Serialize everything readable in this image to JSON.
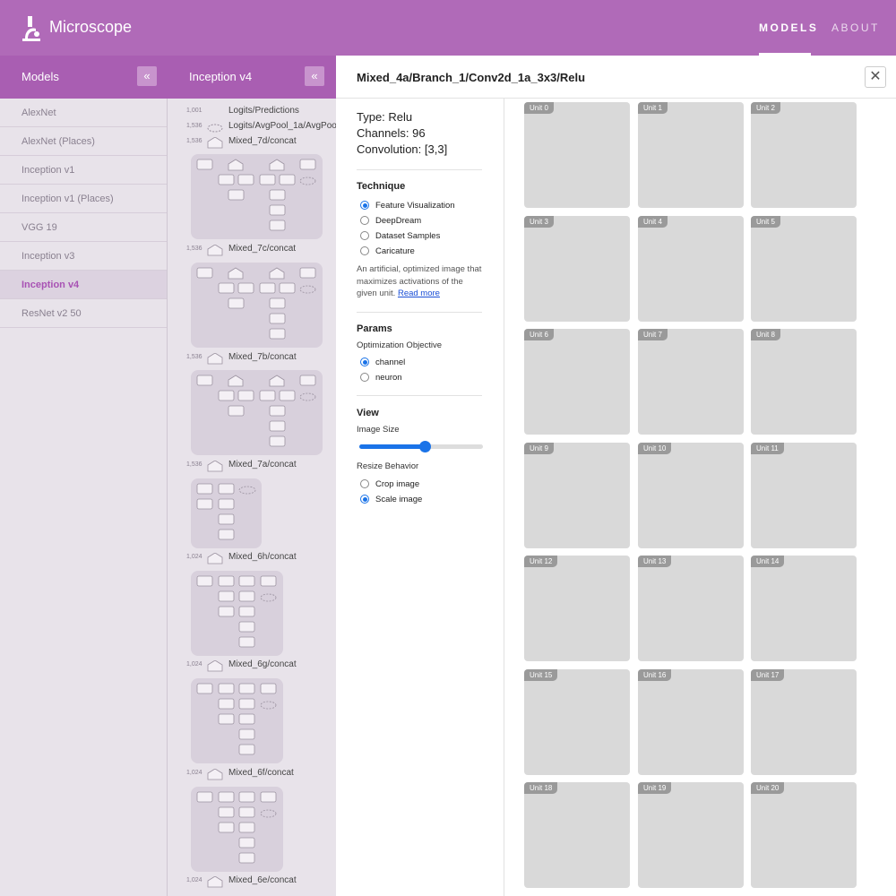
{
  "app": {
    "name": "Microscope"
  },
  "nav": {
    "models": "MODELS",
    "about": "ABOUT"
  },
  "models_panel": {
    "title": "Models",
    "collapse": "«",
    "items": [
      "AlexNet",
      "AlexNet (Places)",
      "Inception v1",
      "Inception v1 (Places)",
      "VGG 19",
      "Inception v3",
      "Inception v4",
      "ResNet v2 50"
    ],
    "active": "Inception v4"
  },
  "graph_panel": {
    "title": "Inception v4",
    "collapse": "«",
    "nodes": [
      {
        "count": "1,001",
        "label": "Logits/Predictions"
      },
      {
        "count": "1,536",
        "label": "Logits/AvgPool_1a/AvgPool"
      },
      {
        "count": "1,536",
        "label": "Mixed_7d/concat"
      },
      {
        "count": "1,536",
        "label": "Mixed_7c/concat"
      },
      {
        "count": "1,536",
        "label": "Mixed_7b/concat"
      },
      {
        "count": "1,536",
        "label": "Mixed_7a/concat"
      },
      {
        "count": "1,024",
        "label": "Mixed_6h/concat"
      },
      {
        "count": "1,024",
        "label": "Mixed_6g/concat"
      },
      {
        "count": "1,024",
        "label": "Mixed_6f/concat"
      },
      {
        "count": "1,024",
        "label": "Mixed_6e/concat"
      }
    ],
    "block_ops": {
      "mixed_7": [
        [
          "1,1",
          "1,3",
          "3,1",
          "1,1"
        ],
        [
          "1,3",
          "3,1",
          "1,3",
          "3,1",
          "1,1"
        ]
      ],
      "mixed_7a": [
        "3,3",
        "3,3",
        "1,1",
        "7,1",
        "1,7",
        "1,1"
      ],
      "mixed_6": [
        "1,1",
        "7,1",
        "1,7",
        "1,1",
        "1,7",
        "7,1",
        "1,1",
        "1,7",
        "7,1",
        "1,1"
      ]
    }
  },
  "detail": {
    "title": "Mixed_4a/Branch_1/Conv2d_1a_3x3/Relu",
    "close": "✕",
    "type": "Type: Relu",
    "channels": "Channels: 96",
    "convolution": "Convolution: [3,3]",
    "technique": {
      "title": "Technique",
      "options": [
        "Feature Visualization",
        "DeepDream",
        "Dataset Samples",
        "Caricature"
      ],
      "selected": "Feature Visualization",
      "description": "An artificial, optimized image that maximizes activations of the given unit.",
      "read_more": "Read more"
    },
    "params": {
      "title": "Params",
      "objective_label": "Optimization Objective",
      "options": [
        "channel",
        "neuron"
      ],
      "selected": "channel"
    },
    "view": {
      "title": "View",
      "image_size_label": "Image Size",
      "image_size_value": 0.53,
      "resize_label": "Resize Behavior",
      "resize_options": [
        "Crop image",
        "Scale image"
      ],
      "resize_selected": "Scale image"
    },
    "units": [
      "Unit 0",
      "Unit 1",
      "Unit 2",
      "Unit 3",
      "Unit 4",
      "Unit 5",
      "Unit 6",
      "Unit 7",
      "Unit 8",
      "Unit 9",
      "Unit 10",
      "Unit 11",
      "Unit 12",
      "Unit 13",
      "Unit 14",
      "Unit 15",
      "Unit 16",
      "Unit 17",
      "Unit 18",
      "Unit 19",
      "Unit 20"
    ]
  },
  "colors": {
    "brand": "#b06ab8",
    "header": "#a95eb2",
    "accent": "#1a73e8"
  },
  "icons": {
    "logo": "microscope-icon",
    "collapse": "double-chevron-left-icon",
    "close": "close-icon"
  }
}
